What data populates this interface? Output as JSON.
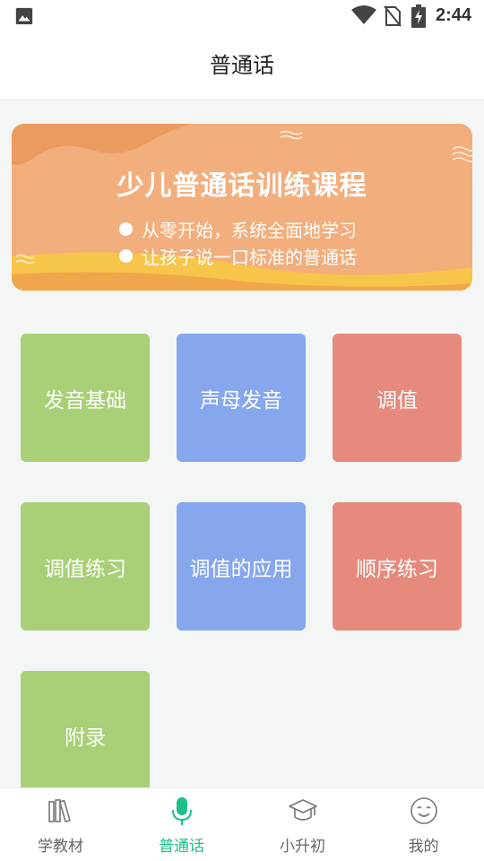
{
  "status_bar": {
    "time": "2:44"
  },
  "header": {
    "title": "普通话"
  },
  "banner": {
    "title": "少儿普通话训练课程",
    "lines": [
      "从零开始，系统全面地学习",
      "让孩子说一口标准的普通话"
    ]
  },
  "tiles": [
    {
      "label": "发音基础",
      "color": "green"
    },
    {
      "label": "声母发音",
      "color": "blue"
    },
    {
      "label": "调值",
      "color": "red"
    },
    {
      "label": "调值练习",
      "color": "green"
    },
    {
      "label": "调值的应用",
      "color": "blue"
    },
    {
      "label": "顺序练习",
      "color": "red"
    },
    {
      "label": "附录",
      "color": "green"
    }
  ],
  "tabs": [
    {
      "label": "学教材",
      "icon": "books-icon",
      "active": false
    },
    {
      "label": "普通话",
      "icon": "microphone-icon",
      "active": true
    },
    {
      "label": "小升初",
      "icon": "graduation-cap-icon",
      "active": false
    },
    {
      "label": "我的",
      "icon": "smiley-face-icon",
      "active": false
    }
  ],
  "colors": {
    "accent": "#1ebe8a",
    "tile_green": "#a9d077",
    "tile_blue": "#86a6ee",
    "tile_red": "#e58a7c",
    "banner": "#f2ae7c"
  }
}
